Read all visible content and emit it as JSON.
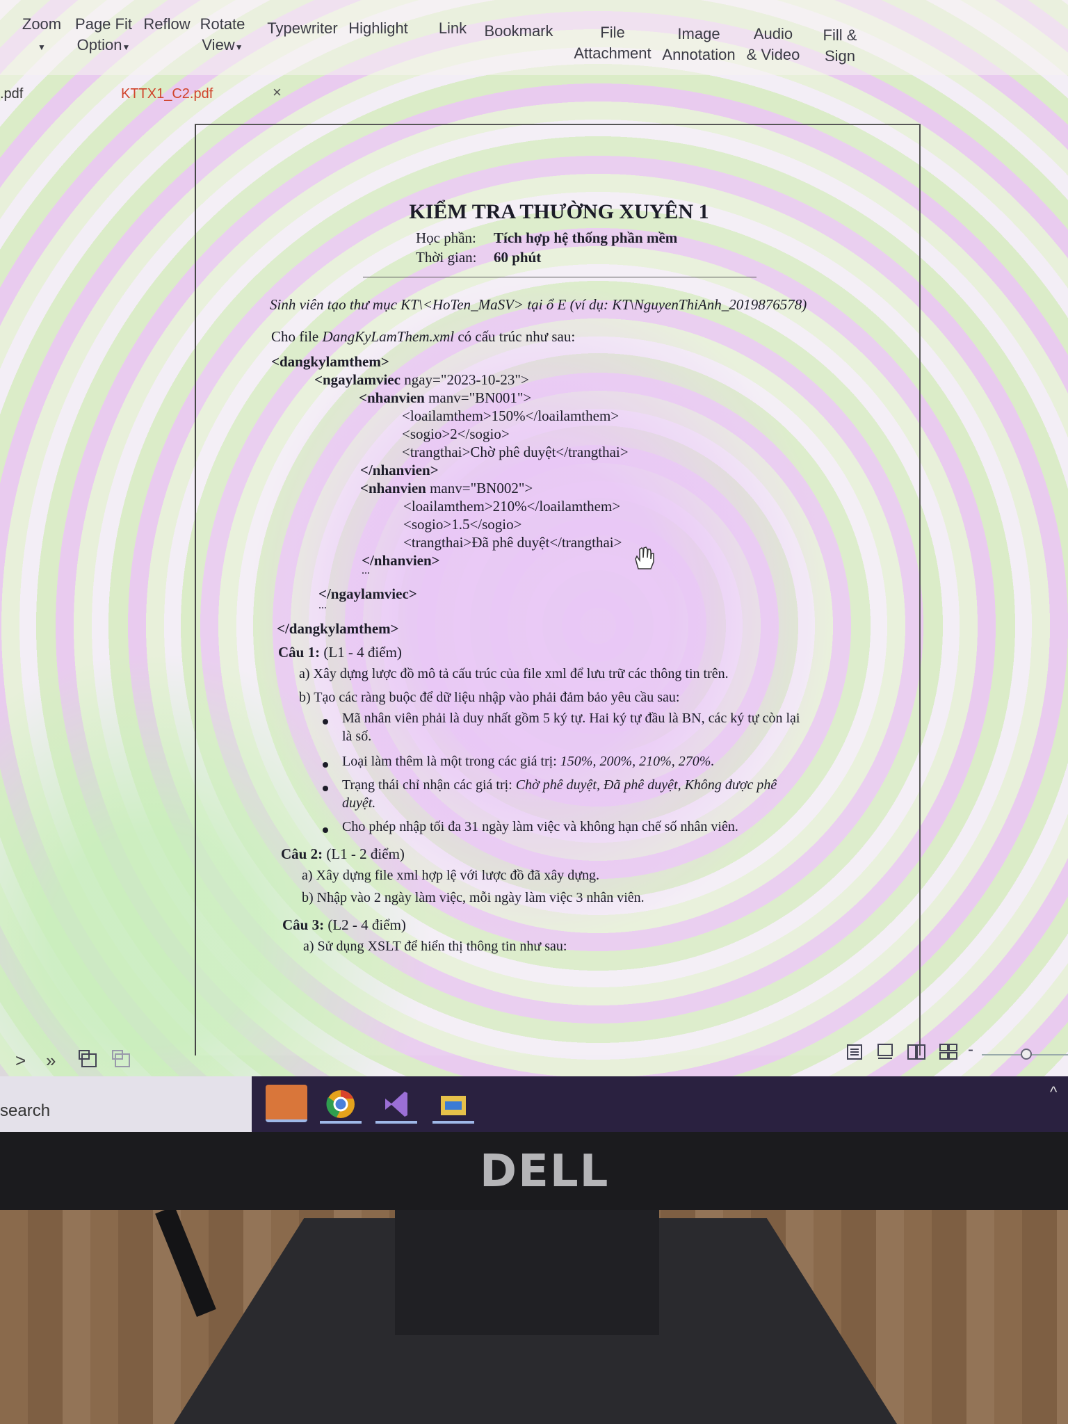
{
  "toolbar": {
    "zoom": "Zoom",
    "page_fit_1": "Page Fit",
    "page_fit_2": "Option",
    "reflow": "Reflow",
    "rotate_1": "Rotate",
    "rotate_2": "View",
    "typewriter": "Typewriter",
    "highlight": "Highlight",
    "link": "Link",
    "bookmark": "Bookmark",
    "file_att_1": "File",
    "file_att_2": "Attachment",
    "image_ann_1": "Image",
    "image_ann_2": "Annotation",
    "audio_1": "Audio",
    "audio_2": "& Video",
    "fill_1": "Fill &",
    "fill_2": "Sign"
  },
  "tabs": {
    "prev_tab": ".pdf",
    "active_tab": "KTTX1_C2.pdf",
    "close": "×"
  },
  "doc": {
    "title": "KIỂM TRA THƯỜNG XUYÊN 1",
    "subject_label": "Học phần:",
    "subject_value": "Tích hợp hệ thống phần mềm",
    "time_label": "Thời gian:",
    "time_value": "60 phút",
    "instruction": "Sinh viên tạo thư mục KT\\<HoTen_MaSV> tại ổ E (ví dụ: KT\\NguyenThiAnh_2019876578)",
    "intro_prefix": "Cho file ",
    "intro_file": "DangKyLamThem.xml",
    "intro_suffix": " có cấu trúc như sau:",
    "xml": {
      "l1": "<dangkylamthem>",
      "l2_tag": "<ngaylamviec",
      "l2_attr": " ngay=\"2023-10-23\">",
      "l3_tag": "<nhanvien",
      "l3_attr": " manv=\"BN001\">",
      "l4": "<loailamthem>150%</loailamthem>",
      "l5": "<sogio>2</sogio>",
      "l6": "<trangthai>Chờ phê duyệt</trangthai>",
      "l7": "</nhanvien>",
      "l8_tag": "<nhanvien",
      "l8_attr": " manv=\"BN002\">",
      "l9": "<loailamthem>210%</loailamthem>",
      "l10": "<sogio>1.5</sogio>",
      "l11": "<trangthai>Đã phê duyệt</trangthai>",
      "l12": "</nhanvien>",
      "dots1": "...",
      "l13": "</ngaylamviec>",
      "dots2": "...",
      "l14": "</dangkylamthem>"
    },
    "q1_label": "Câu 1:",
    "q1_points": " (L1 - 4 điểm)",
    "q1a": "a)  Xây dựng lược đồ mô tả cấu trúc của file xml để lưu trữ các thông tin trên.",
    "q1b": "b)  Tạo các ràng buộc để dữ liệu nhập vào phải đảm bảo yêu cầu sau:",
    "bullet1_l1": "Mã nhân viên phải là duy nhất gồm 5 ký tự. Hai ký tự đầu là BN, các ký tự còn lại",
    "bullet1_l2": "là số.",
    "bullet2_prefix": "Loại làm thêm là một trong các giá trị: ",
    "bullet2_values": "150%, 200%, 210%, 270%.",
    "bullet3_prefix": "Trạng thái chỉ nhận các giá trị: ",
    "bullet3_values_l1": "Chờ phê duyệt, Đã phê duyệt, Không được phê",
    "bullet3_values_l2": "duyệt.",
    "bullet4": "Cho phép nhập tối đa 31 ngày làm việc và không hạn chế số nhân viên.",
    "q2_label": "Câu 2:",
    "q2_points": " (L1 - 2 điểm)",
    "q2a": "a)  Xây dựng file xml hợp lệ với lược đồ đã xây dựng.",
    "q2b": "b)  Nhập vào 2 ngày làm việc, mỗi ngày làm việc 3 nhân viên.",
    "q3_label": "Câu 3:",
    "q3_points": " (L2 - 4 điểm)",
    "q3a": "a) Sử dụng XSLT để hiển thị thông tin như sau:"
  },
  "taskbar": {
    "search_text": "search"
  },
  "monitor": {
    "brand": "DELL"
  },
  "colors": {
    "active_tab": "#d0442c",
    "taskbar": "#2a2140",
    "text": "#1c1c28"
  }
}
